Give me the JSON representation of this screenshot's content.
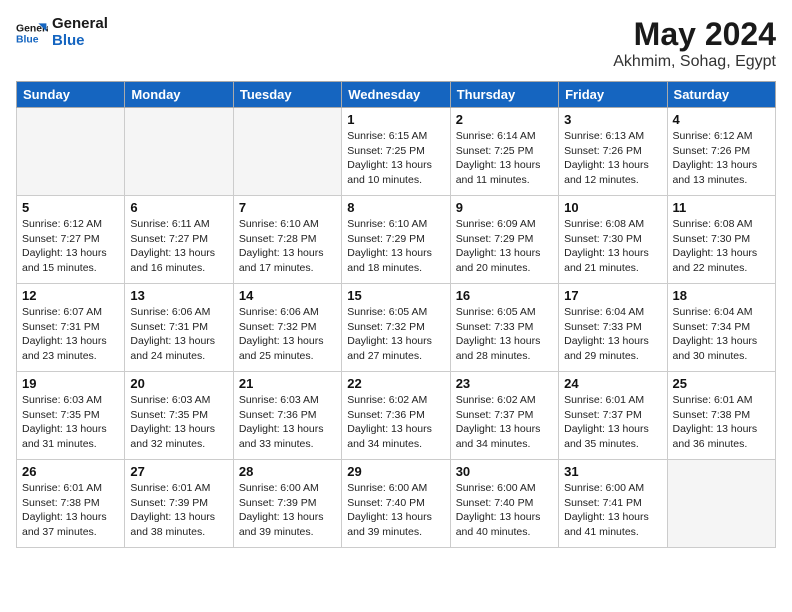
{
  "header": {
    "logo_line1": "General",
    "logo_line2": "Blue",
    "month_title": "May 2024",
    "location": "Akhmim, Sohag, Egypt"
  },
  "weekdays": [
    "Sunday",
    "Monday",
    "Tuesday",
    "Wednesday",
    "Thursday",
    "Friday",
    "Saturday"
  ],
  "weeks": [
    [
      {
        "day": "",
        "info": ""
      },
      {
        "day": "",
        "info": ""
      },
      {
        "day": "",
        "info": ""
      },
      {
        "day": "1",
        "info": "Sunrise: 6:15 AM\nSunset: 7:25 PM\nDaylight: 13 hours\nand 10 minutes."
      },
      {
        "day": "2",
        "info": "Sunrise: 6:14 AM\nSunset: 7:25 PM\nDaylight: 13 hours\nand 11 minutes."
      },
      {
        "day": "3",
        "info": "Sunrise: 6:13 AM\nSunset: 7:26 PM\nDaylight: 13 hours\nand 12 minutes."
      },
      {
        "day": "4",
        "info": "Sunrise: 6:12 AM\nSunset: 7:26 PM\nDaylight: 13 hours\nand 13 minutes."
      }
    ],
    [
      {
        "day": "5",
        "info": "Sunrise: 6:12 AM\nSunset: 7:27 PM\nDaylight: 13 hours\nand 15 minutes."
      },
      {
        "day": "6",
        "info": "Sunrise: 6:11 AM\nSunset: 7:27 PM\nDaylight: 13 hours\nand 16 minutes."
      },
      {
        "day": "7",
        "info": "Sunrise: 6:10 AM\nSunset: 7:28 PM\nDaylight: 13 hours\nand 17 minutes."
      },
      {
        "day": "8",
        "info": "Sunrise: 6:10 AM\nSunset: 7:29 PM\nDaylight: 13 hours\nand 18 minutes."
      },
      {
        "day": "9",
        "info": "Sunrise: 6:09 AM\nSunset: 7:29 PM\nDaylight: 13 hours\nand 20 minutes."
      },
      {
        "day": "10",
        "info": "Sunrise: 6:08 AM\nSunset: 7:30 PM\nDaylight: 13 hours\nand 21 minutes."
      },
      {
        "day": "11",
        "info": "Sunrise: 6:08 AM\nSunset: 7:30 PM\nDaylight: 13 hours\nand 22 minutes."
      }
    ],
    [
      {
        "day": "12",
        "info": "Sunrise: 6:07 AM\nSunset: 7:31 PM\nDaylight: 13 hours\nand 23 minutes."
      },
      {
        "day": "13",
        "info": "Sunrise: 6:06 AM\nSunset: 7:31 PM\nDaylight: 13 hours\nand 24 minutes."
      },
      {
        "day": "14",
        "info": "Sunrise: 6:06 AM\nSunset: 7:32 PM\nDaylight: 13 hours\nand 25 minutes."
      },
      {
        "day": "15",
        "info": "Sunrise: 6:05 AM\nSunset: 7:32 PM\nDaylight: 13 hours\nand 27 minutes."
      },
      {
        "day": "16",
        "info": "Sunrise: 6:05 AM\nSunset: 7:33 PM\nDaylight: 13 hours\nand 28 minutes."
      },
      {
        "day": "17",
        "info": "Sunrise: 6:04 AM\nSunset: 7:33 PM\nDaylight: 13 hours\nand 29 minutes."
      },
      {
        "day": "18",
        "info": "Sunrise: 6:04 AM\nSunset: 7:34 PM\nDaylight: 13 hours\nand 30 minutes."
      }
    ],
    [
      {
        "day": "19",
        "info": "Sunrise: 6:03 AM\nSunset: 7:35 PM\nDaylight: 13 hours\nand 31 minutes."
      },
      {
        "day": "20",
        "info": "Sunrise: 6:03 AM\nSunset: 7:35 PM\nDaylight: 13 hours\nand 32 minutes."
      },
      {
        "day": "21",
        "info": "Sunrise: 6:03 AM\nSunset: 7:36 PM\nDaylight: 13 hours\nand 33 minutes."
      },
      {
        "day": "22",
        "info": "Sunrise: 6:02 AM\nSunset: 7:36 PM\nDaylight: 13 hours\nand 34 minutes."
      },
      {
        "day": "23",
        "info": "Sunrise: 6:02 AM\nSunset: 7:37 PM\nDaylight: 13 hours\nand 34 minutes."
      },
      {
        "day": "24",
        "info": "Sunrise: 6:01 AM\nSunset: 7:37 PM\nDaylight: 13 hours\nand 35 minutes."
      },
      {
        "day": "25",
        "info": "Sunrise: 6:01 AM\nSunset: 7:38 PM\nDaylight: 13 hours\nand 36 minutes."
      }
    ],
    [
      {
        "day": "26",
        "info": "Sunrise: 6:01 AM\nSunset: 7:38 PM\nDaylight: 13 hours\nand 37 minutes."
      },
      {
        "day": "27",
        "info": "Sunrise: 6:01 AM\nSunset: 7:39 PM\nDaylight: 13 hours\nand 38 minutes."
      },
      {
        "day": "28",
        "info": "Sunrise: 6:00 AM\nSunset: 7:39 PM\nDaylight: 13 hours\nand 39 minutes."
      },
      {
        "day": "29",
        "info": "Sunrise: 6:00 AM\nSunset: 7:40 PM\nDaylight: 13 hours\nand 39 minutes."
      },
      {
        "day": "30",
        "info": "Sunrise: 6:00 AM\nSunset: 7:40 PM\nDaylight: 13 hours\nand 40 minutes."
      },
      {
        "day": "31",
        "info": "Sunrise: 6:00 AM\nSunset: 7:41 PM\nDaylight: 13 hours\nand 41 minutes."
      },
      {
        "day": "",
        "info": ""
      }
    ]
  ]
}
